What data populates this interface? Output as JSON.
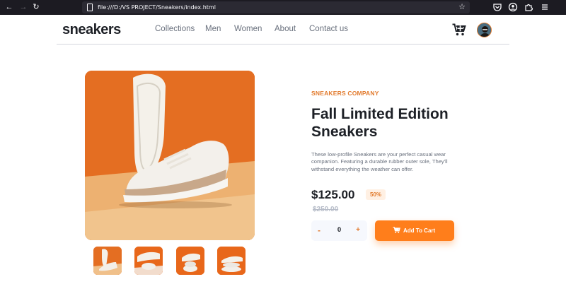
{
  "browser": {
    "url": "file:///D:/VS PROJECT/Sneakers/index.html",
    "icons": [
      "back-arrow-icon",
      "forward-arrow-icon",
      "reload-icon",
      "bookmark-star-icon",
      "pocket-icon",
      "account-icon",
      "extensions-icon",
      "menu-icon"
    ]
  },
  "header": {
    "logo": "sneakers",
    "nav": [
      "Collections",
      "Men",
      "Women",
      "About",
      "Contact us"
    ]
  },
  "product": {
    "company": "SNEAKERS COMPANY",
    "title": "Fall Limited Edition Sneakers",
    "description": "These low-profile Sneakers are your perfect casual wear companion. Featuring a durable rubber outer sole, They'll withstand everything the weather can offer.",
    "price": "$125.00",
    "discount": "50%",
    "original_price": "$250.00",
    "quantity": "0",
    "minus_label": "-",
    "plus_label": "+",
    "add_to_cart_label": "Add To Cart"
  },
  "colors": {
    "accent": "#ff7e1b",
    "accent_text": "#e27b2e",
    "dark": "#1d2026",
    "muted": "#69707d",
    "discount_bg": "#fff0e3"
  }
}
